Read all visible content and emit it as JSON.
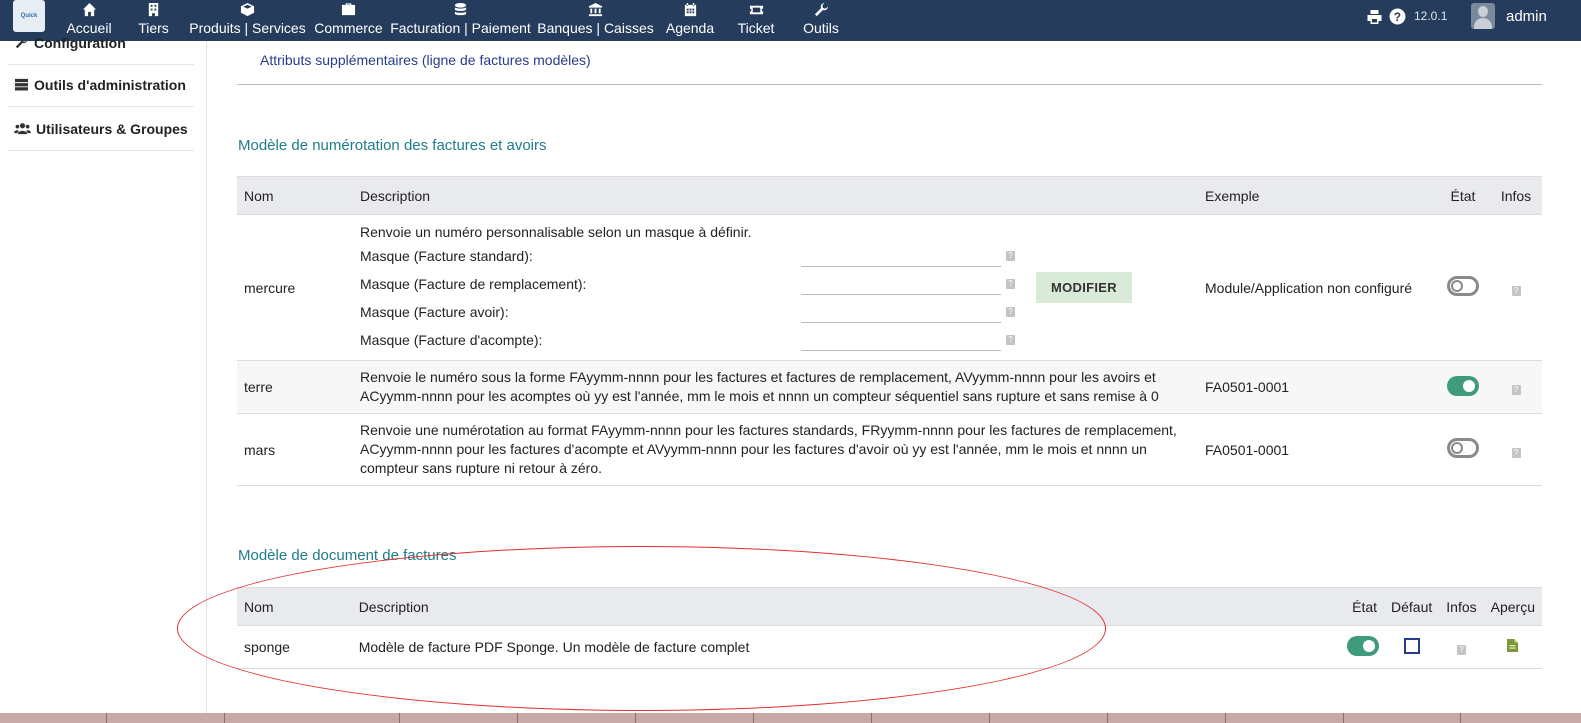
{
  "topbar": {
    "logo_text": "Quick",
    "nav": [
      {
        "label": "Accueil",
        "icon": "home-icon"
      },
      {
        "label": "Tiers",
        "icon": "building-icon"
      },
      {
        "label": "Produits | Services",
        "icon": "cube-icon"
      },
      {
        "label": "Commerce",
        "icon": "briefcase-icon"
      },
      {
        "label": "Facturation | Paiement",
        "icon": "coins-icon"
      },
      {
        "label": "Banques | Caisses",
        "icon": "bank-icon"
      },
      {
        "label": "Agenda",
        "icon": "calendar-icon"
      },
      {
        "label": "Ticket",
        "icon": "ticket-icon"
      },
      {
        "label": "Outils",
        "icon": "wrench-icon"
      }
    ],
    "version": "12.0.1",
    "user": "admin"
  },
  "sidebar": {
    "items": [
      {
        "label": "Configuration",
        "icon": "wrench-icon"
      },
      {
        "label": "Outils d'administration",
        "icon": "server-icon"
      },
      {
        "label": "Utilisateurs & Groupes",
        "icon": "users-icon"
      }
    ]
  },
  "main": {
    "extra_attributes_link": "Attributs supplémentaires (ligne de factures modèles)",
    "numbering": {
      "title": "Modèle de numérotation des factures et avoirs",
      "headers": {
        "nom": "Nom",
        "description": "Description",
        "exemple": "Exemple",
        "etat": "État",
        "infos": "Infos"
      },
      "mercure": {
        "name": "mercure",
        "intro": "Renvoie un numéro personnalisable selon un masque à définir.",
        "masks": [
          {
            "label": "Masque (Facture standard):",
            "value": ""
          },
          {
            "label": "Masque (Facture de remplacement):",
            "value": ""
          },
          {
            "label": "Masque (Facture avoir):",
            "value": ""
          },
          {
            "label": "Masque (Facture d'acompte):",
            "value": ""
          }
        ],
        "button": "MODIFIER",
        "example": "Module/Application non configuré",
        "state": "off"
      },
      "terre": {
        "name": "terre",
        "description_line1": "Renvoie le numéro sous la forme FAyymm-nnnn pour les factures et factures de remplacement, AVyymm-nnnn pour les avoirs et",
        "description_line2": "ACyymm-nnnn pour les acomptes où yy est l'année, mm le mois et nnnn un compteur séquentiel sans rupture et sans remise à 0",
        "example": "FA0501-0001",
        "state": "on"
      },
      "mars": {
        "name": "mars",
        "description_line1": "Renvoie une numérotation au format FAyymm-nnnn pour les factures standards, FRyymm-nnnn pour les factures de remplacement,",
        "description_line2": "ACyymm-nnnn pour les factures d'acompte et AVyymm-nnnn pour les factures d'avoir où yy est l'année, mm le mois et nnnn un",
        "description_line3": "compteur sans rupture ni retour à zéro.",
        "example": "FA0501-0001",
        "state": "off"
      }
    },
    "documents": {
      "title": "Modèle de document de factures",
      "headers": {
        "nom": "Nom",
        "description": "Description",
        "etat": "État",
        "defaut": "Défaut",
        "infos": "Infos",
        "apercu": "Aperçu"
      },
      "row": {
        "name": "sponge",
        "description": "Modèle de facture PDF Sponge. Un modèle de facture complet",
        "state": "on",
        "default": false
      }
    },
    "help_glyph": "?"
  },
  "colors": {
    "topbar_bg": "#263c5c",
    "section_title": "#1e7d8a",
    "toggle_on": "#3e9c7a",
    "annotation_oval": "#e03030"
  }
}
